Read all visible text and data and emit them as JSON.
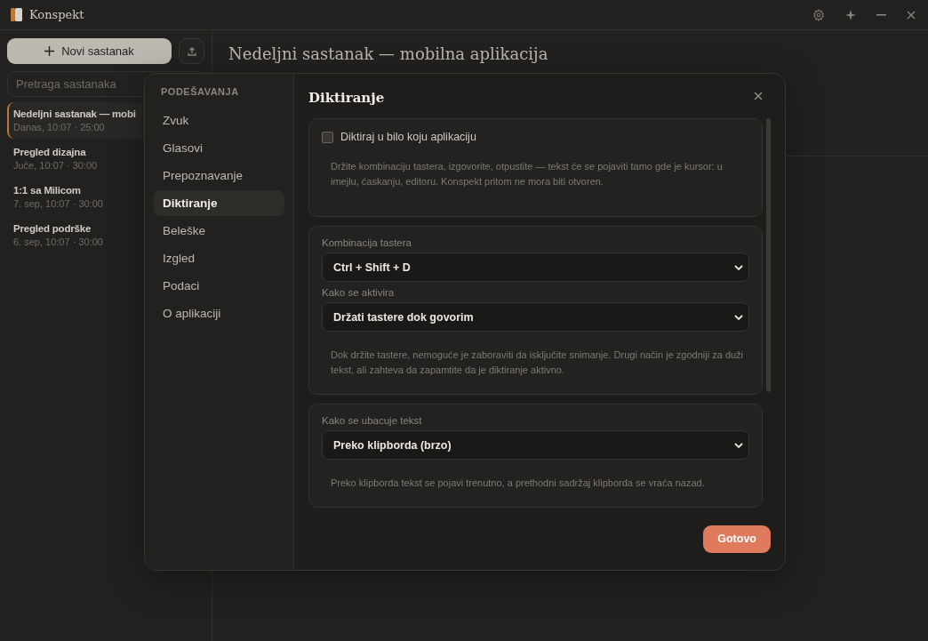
{
  "app": {
    "title": "Konspekt"
  },
  "sidebar": {
    "new_button": "Novi sastanak",
    "search": {
      "placeholder": "Pretraga sastanaka"
    },
    "meetings": [
      {
        "title": "Nedeljni sastanak — mobi",
        "meta": "Danas, 10:07 · 25:00",
        "selected": true
      },
      {
        "title": "Pregled dizajna",
        "meta": "Juče, 10:07 · 30:00",
        "selected": false
      },
      {
        "title": "1:1 sa Milicom",
        "meta": "7. sep, 10:07 · 30:00",
        "selected": false
      },
      {
        "title": "Pregled podrške",
        "meta": "6. sep, 10:07 · 30:00",
        "selected": false
      }
    ]
  },
  "main": {
    "title": "Nedeljni sastanak — mobilna aplikacija"
  },
  "settings": {
    "heading": "PODEŠAVANJA",
    "nav": [
      {
        "label": "Zvuk",
        "selected": false
      },
      {
        "label": "Glasovi",
        "selected": false
      },
      {
        "label": "Prepoznavanje",
        "selected": false
      },
      {
        "label": "Diktiranje",
        "selected": true
      },
      {
        "label": "Beleške",
        "selected": false
      },
      {
        "label": "Izgled",
        "selected": false
      },
      {
        "label": "Podaci",
        "selected": false
      },
      {
        "label": "O aplikaciji",
        "selected": false
      }
    ],
    "panel": {
      "title": "Diktiranje",
      "cards": [
        {
          "items": [
            {
              "kind": "checkbox",
              "label": "Diktiraj u bilo koju aplikaciju",
              "checked": false
            },
            {
              "kind": "note",
              "text": "Držite kombinaciju tastera, izgovorite, otpustite — tekst će se pojaviti tamo gde je kursor: u imejlu, ćaskanju, editoru. Konspekt pritom ne mora biti otvoren."
            }
          ]
        },
        {
          "items": [
            {
              "kind": "select",
              "label": "Kombinacija tastera",
              "value": "Ctrl + Shift + D"
            },
            {
              "kind": "select",
              "label": "Kako se aktivira",
              "value": "Držati tastere dok govorim"
            },
            {
              "kind": "note",
              "text": "Dok držite tastere, nemoguće je zaboraviti da isključite snimanje. Drugi način je zgodniji za duži tekst, ali zahteva da zapamtite da je diktiranje aktivno."
            }
          ]
        },
        {
          "items": [
            {
              "kind": "select",
              "label": "Kako se ubacuje tekst",
              "value": "Preko klipborda (brzo)"
            },
            {
              "kind": "note",
              "text": "Preko klipborda tekst se pojavi trenutno, a prethodni sadržaj klipborda se vraća nazad."
            }
          ]
        }
      ]
    },
    "done_button": "Gotovo"
  }
}
